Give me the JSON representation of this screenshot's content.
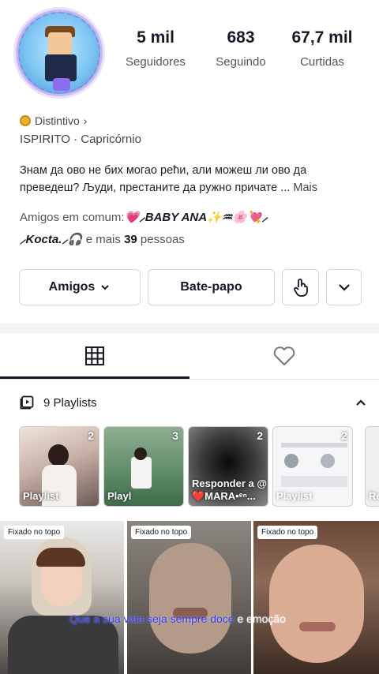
{
  "stats": [
    {
      "value": "5 mil",
      "label": "Seguidores"
    },
    {
      "value": "683",
      "label": "Seguindo"
    },
    {
      "value": "67,7 mil",
      "label": "Curtidas"
    }
  ],
  "badge": {
    "label": "Distintivo",
    "chevron": "›",
    "icon": "coin-badge-icon"
  },
  "meta": "ISPIRITO · Capricórnio",
  "bio": {
    "text": "Знам да ово не бих могао рећи, али можеш ли ово да преведеш? Људи, престаните да ружно причате ...",
    "more": "Mais"
  },
  "mutual": {
    "prefix": "Amigos em comum:",
    "name1": "💗⸝BABY ANA✨♒︎🌸💘⸝",
    "name2": "⸝Kocta.⸝🎧",
    "suffix_pre": "e mais ",
    "count": "39",
    "suffix_post": " pessoas"
  },
  "actions": {
    "friends": "Amigos",
    "chat": "Bate-papo"
  },
  "tabs": {
    "videos_icon": "grid-icon",
    "liked_icon": "heart-outline-icon"
  },
  "playlists": {
    "header": "9 Playlists",
    "items": [
      {
        "count": "2",
        "title": "Playlist"
      },
      {
        "count": "3",
        "title": "Playl"
      },
      {
        "count": "2",
        "title": "Responder a @❤️MARA•ᵉⁿ..."
      },
      {
        "count": "2",
        "title": "Playlist"
      },
      {
        "count": "",
        "title": "Re"
      }
    ]
  },
  "videos": [
    {
      "pinned": "Fixado no topo"
    },
    {
      "pinned": "Fixado no topo"
    },
    {
      "pinned": "Fixado no topo"
    }
  ],
  "caption": {
    "blue": "Que a sua vida seja sempre doce",
    "white": " e emoção"
  },
  "colors": {
    "text": "#161823",
    "heart": "#e6397a",
    "caption": "#2f3bff",
    "badge": "#e8b32e"
  }
}
